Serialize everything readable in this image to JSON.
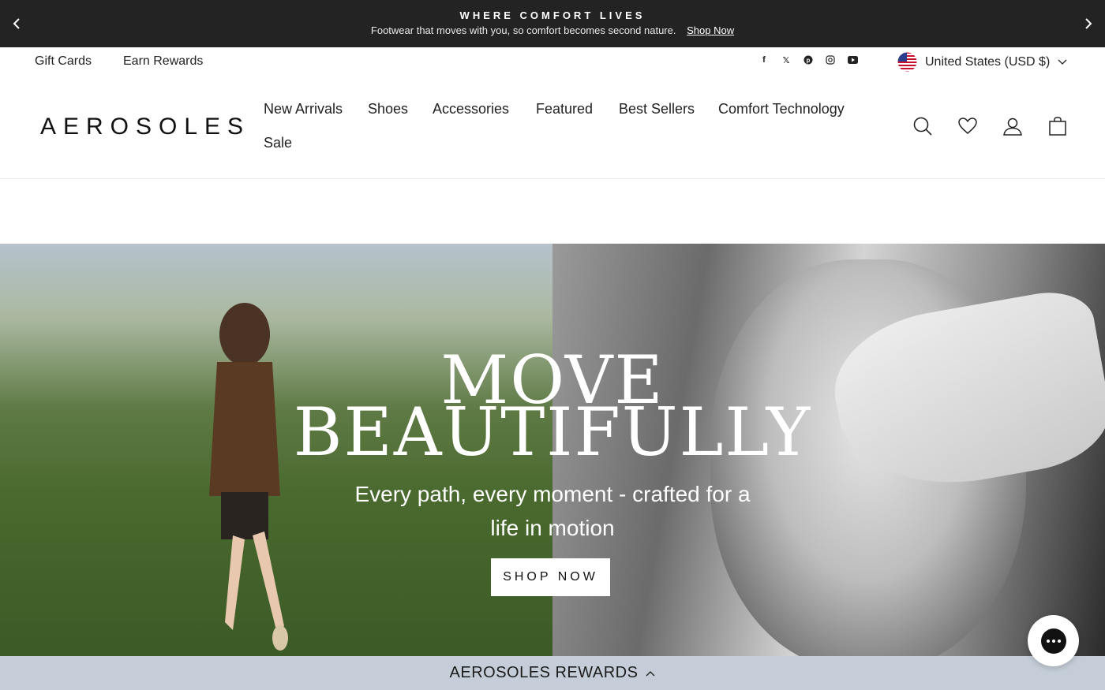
{
  "announcement": {
    "title": "WHERE COMFORT LIVES",
    "message": "Footwear that moves with you, so comfort becomes second nature.",
    "link": "Shop Now"
  },
  "utility": {
    "links": [
      "Gift Cards",
      "Earn Rewards"
    ],
    "socials": [
      "facebook-icon",
      "x-icon",
      "pinterest-icon",
      "instagram-icon",
      "youtube-icon"
    ],
    "country": "United States (USD $)"
  },
  "header": {
    "logo": "AEROSOLES",
    "nav": [
      "New Arrivals",
      "Shoes",
      "Accessories",
      "Featured",
      "Best Sellers",
      "Comfort Technology",
      "Sale"
    ],
    "icons": [
      "search-icon",
      "wishlist-heart-icon",
      "account-icon",
      "cart-bag-icon"
    ]
  },
  "hero": {
    "headline_line1": "MOVE",
    "headline_line2": "BEAUTIFULLY",
    "tagline": "Every path, every moment - crafted for a life in motion",
    "cta": "SHOP NOW"
  },
  "rewards": {
    "label": "AEROSOLES REWARDS"
  },
  "colors": {
    "announcement_bg": "#232323",
    "rewards_bg": "#c5ced8",
    "text": "#111111"
  }
}
